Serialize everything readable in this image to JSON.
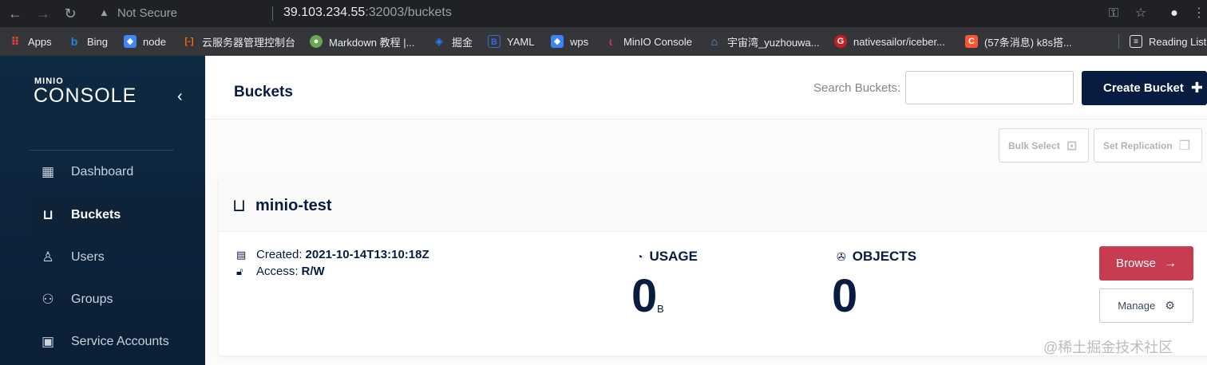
{
  "browser": {
    "not_secure": "Not Secure",
    "url_host": "39.103.234.55",
    "url_rest": ":32003/buckets",
    "bookmarks": [
      {
        "label": "Apps",
        "icon": "apps-grid-icon",
        "color": "#ea4335"
      },
      {
        "label": "Bing",
        "icon": "bing-icon",
        "color": "#1e88e5"
      },
      {
        "label": "node",
        "icon": "node-icon",
        "color": "#4285f4"
      },
      {
        "label": "云服务器管理控制台",
        "icon": "aliyun-icon",
        "color": "#ff6a00"
      },
      {
        "label": "Markdown 教程 |...",
        "icon": "markdown-icon",
        "color": "#6aa84f"
      },
      {
        "label": "掘金",
        "icon": "juejin-icon",
        "color": "#1e80ff"
      },
      {
        "label": "YAML",
        "icon": "yaml-icon",
        "color": "#2f6fd1"
      },
      {
        "label": "wps",
        "icon": "wps-icon",
        "color": "#3b82f6"
      },
      {
        "label": "MinIO Console",
        "icon": "minio-icon",
        "color": "#c83b51"
      },
      {
        "label": "宇宙湾_yuzhouwa...",
        "icon": "home-icon",
        "color": "#5aa0f2"
      },
      {
        "label": "nativesailor/iceber...",
        "icon": "gitee-icon",
        "color": "#c71d23"
      },
      {
        "label": "(57条消息) k8s搭...",
        "icon": "csdn-icon",
        "color": "#fc5531"
      },
      {
        "label": "Reading List",
        "icon": "reading-list-icon",
        "color": "#35363a"
      }
    ]
  },
  "sidebar": {
    "logo_small": "MINIO",
    "logo_big": "CONSOLE",
    "items": [
      {
        "label": "Dashboard",
        "icon": "dashboard-icon"
      },
      {
        "label": "Buckets",
        "icon": "bucket-icon"
      },
      {
        "label": "Users",
        "icon": "user-icon"
      },
      {
        "label": "Groups",
        "icon": "groups-icon"
      },
      {
        "label": "Service Accounts",
        "icon": "service-accounts-icon"
      }
    ],
    "active_item": "Buckets"
  },
  "header": {
    "title": "Buckets",
    "search_label": "Search Buckets:",
    "create_label": "Create Bucket"
  },
  "toolbar": {
    "bulk_select": "Bulk Select",
    "set_replication": "Set Replication"
  },
  "bucket": {
    "name": "minio-test",
    "created_label": "Created:",
    "created_value": "2021-10-14T13:10:18Z",
    "access_label": "Access:",
    "access_value": "R/W",
    "usage_label": "USAGE",
    "usage_value": "0",
    "usage_unit": "B",
    "objects_label": "OBJECTS",
    "objects_value": "0",
    "browse_label": "Browse",
    "manage_label": "Manage"
  },
  "watermark": "@稀土掘金技术社区",
  "colors": {
    "sidebar_bg": "#0f2942",
    "primary": "#081c42",
    "browse": "#c83b51"
  }
}
